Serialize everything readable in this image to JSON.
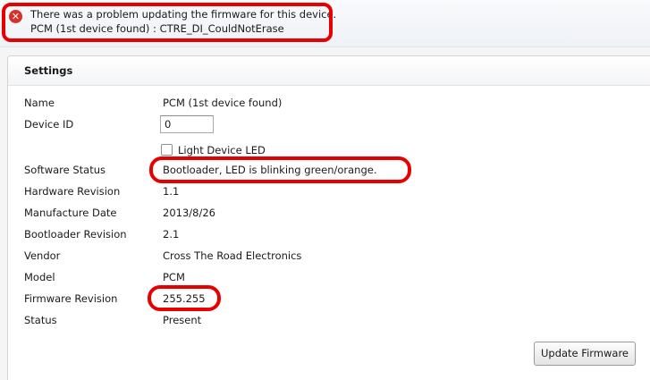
{
  "error": {
    "icon": "error-x-icon",
    "line1": "There was a problem updating the firmware for this device.",
    "line2": "PCM (1st device found) : CTRE_DI_CouldNotErase",
    "icon_color": "#d9302c"
  },
  "settings": {
    "title": "Settings",
    "name_label": "Name",
    "name_value": "PCM (1st device found)",
    "device_id_label": "Device ID",
    "device_id_value": "0",
    "light_led_label": "Light Device LED",
    "light_led_checked": false,
    "software_status_label": "Software Status",
    "software_status_value": "Bootloader, LED is blinking green/orange.",
    "hardware_revision_label": "Hardware Revision",
    "hardware_revision_value": "1.1",
    "manufacture_date_label": "Manufacture Date",
    "manufacture_date_value": "2013/8/26",
    "bootloader_revision_label": "Bootloader Revision",
    "bootloader_revision_value": "2.1",
    "vendor_label": "Vendor",
    "vendor_value": "Cross The Road Electronics",
    "model_label": "Model",
    "model_value": "PCM",
    "firmware_revision_label": "Firmware Revision",
    "firmware_revision_value": "255.255",
    "status_label": "Status",
    "status_value": "Present",
    "update_button_label": "Update Firmware"
  },
  "highlight_color": "#e60000"
}
